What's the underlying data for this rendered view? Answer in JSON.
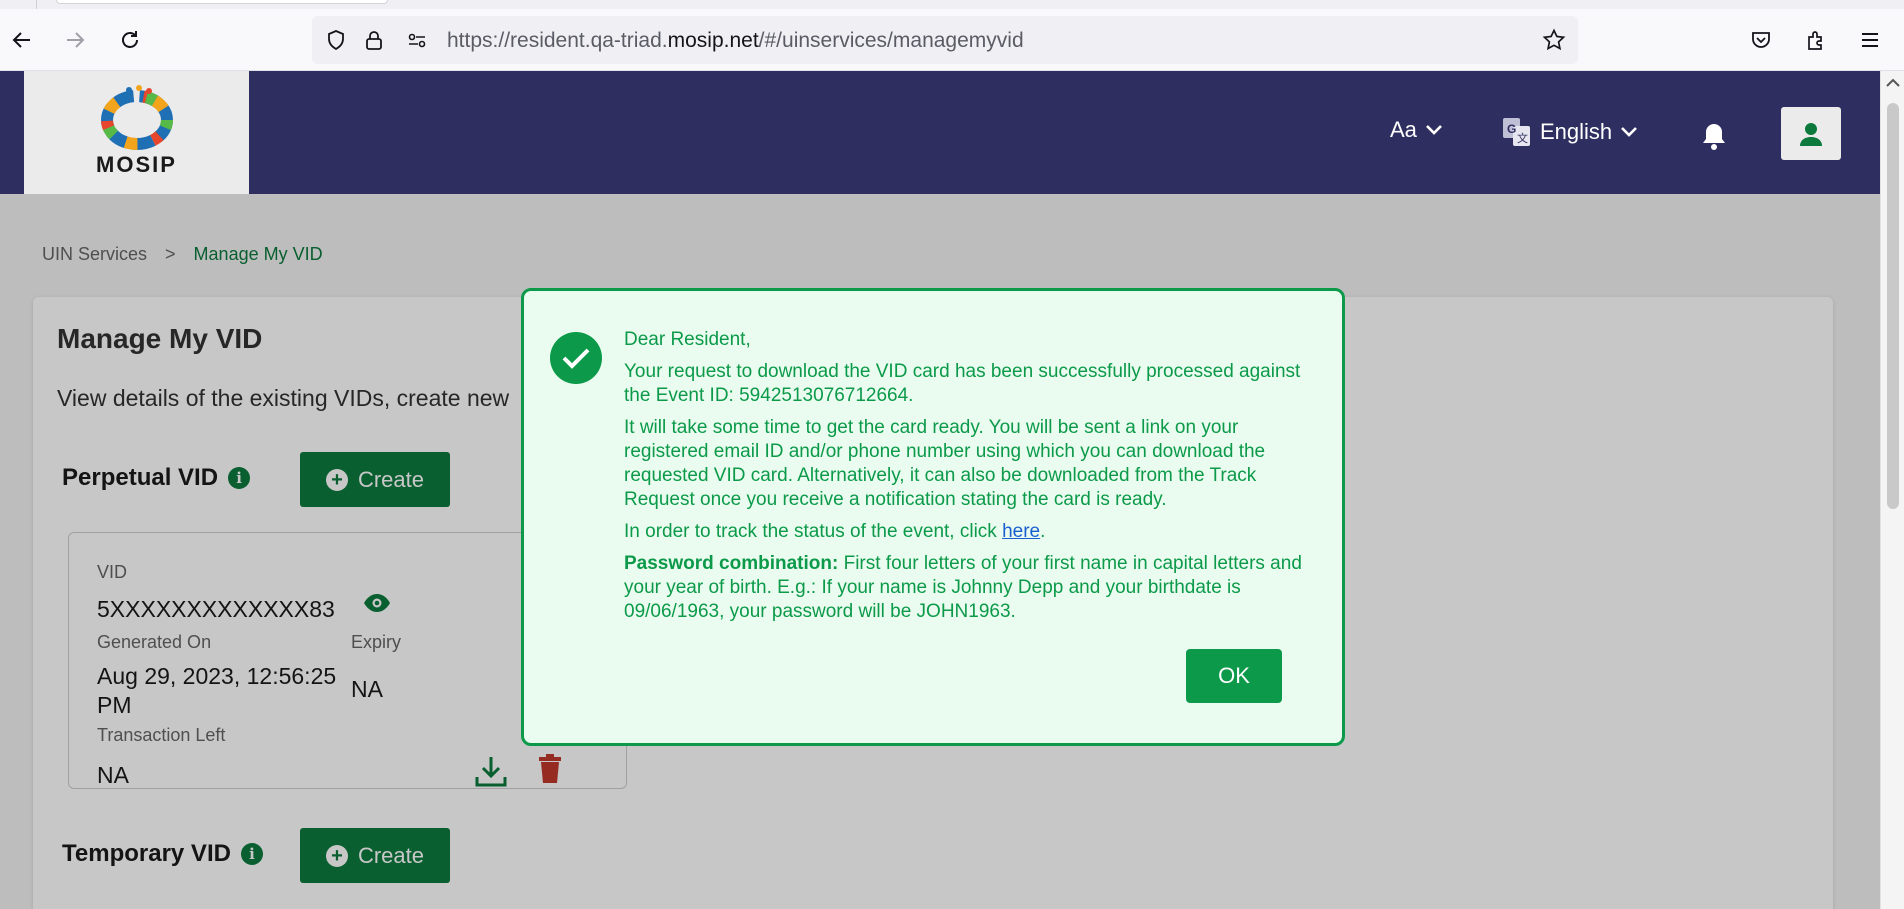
{
  "browser": {
    "url_prefix": "https://resident.qa-triad.",
    "url_host": "mosip.net",
    "url_path": "/#/uinservices/managemyvid"
  },
  "header": {
    "logo_text": "MOSIP",
    "font_size_label": "Aa",
    "language_label": "English"
  },
  "breadcrumb": {
    "parent": "UIN Services",
    "separator": ">",
    "current": "Manage My VID"
  },
  "page": {
    "title": "Manage My VID",
    "subtitle": "View details of the existing VIDs, create new"
  },
  "sections": {
    "perpetual": {
      "title": "Perpetual VID",
      "info_icon": "i",
      "create_label": "Create"
    },
    "temporary": {
      "title": "Temporary VID",
      "info_icon": "i",
      "create_label": "Create"
    }
  },
  "vid_card": {
    "vid_label": "VID",
    "vid_value": "5XXXXXXXXXXXXX83",
    "generated_label": "Generated On",
    "generated_value": "Aug 29, 2023, 12:56:25 PM",
    "expiry_label": "Expiry",
    "expiry_value": "NA",
    "transactions_label": "Transaction Left",
    "transactions_value": "NA"
  },
  "modal": {
    "greeting": "Dear Resident,",
    "line1": "Your request to download the VID card has been successfully processed against the Event ID: 5942513076712664.",
    "line2": "It will take some time to get the card ready. You will be sent a link on your registered email ID and/or phone number using which you can download the requested VID card. Alternatively, it can also be downloaded from the Track Request once you receive a notification stating the card is ready.",
    "track_prefix": "In order to track the status of the event, click ",
    "track_link": "here",
    "track_suffix": ".",
    "password_label": "Password combination:",
    "password_text": " First four letters of your first name in capital letters and your year of birth. E.g.: If your name is Johnny Depp and your birthdate is 09/06/1963, your password will be JOHN1963.",
    "ok_label": "OK"
  },
  "colors": {
    "header_bg": "#2e2f60",
    "primary_green": "#0c7a3d",
    "modal_green": "#0c9a4a",
    "modal_bg": "#eafcef",
    "delete_red": "#c0392b",
    "link_blue": "#1a5fd0"
  },
  "icons": {
    "nav": [
      "back-icon",
      "forward-icon",
      "reload-icon"
    ],
    "urlbar": [
      "shield-icon",
      "lock-icon",
      "permissions-icon",
      "bookmark-star-icon"
    ],
    "toolbar_right": [
      "pocket-icon",
      "extensions-icon",
      "menu-icon"
    ],
    "header": [
      "chevron-down-icon",
      "translate-icon",
      "bell-icon",
      "user-icon"
    ],
    "card": [
      "eye-icon",
      "download-icon",
      "trash-icon"
    ],
    "modal": [
      "check-icon"
    ]
  }
}
